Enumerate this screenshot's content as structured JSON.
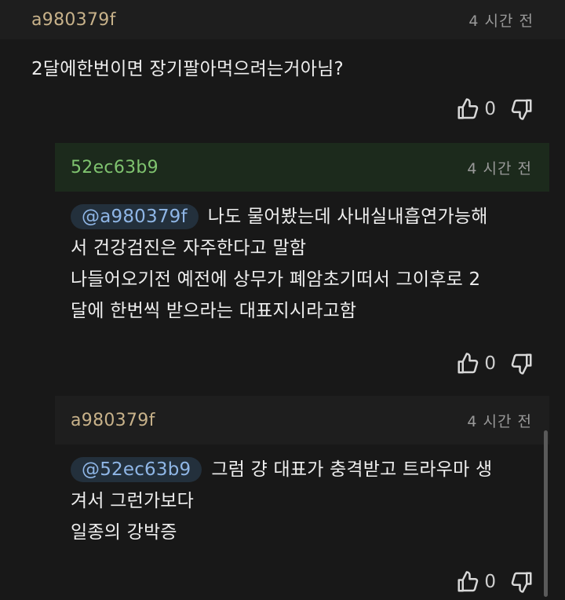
{
  "comments": [
    {
      "author": "a980379f",
      "time": "4 시간 전",
      "mention": "",
      "lines": [
        "2달에한번이면 장기팔아먹으려는거아님?"
      ],
      "up_count": "0"
    },
    {
      "author": "52ec63b9",
      "time": "4 시간 전",
      "mention": "@a980379f",
      "lines": [
        "나도 물어봤는데 사내실내흡연가능해",
        "서 건강검진은 자주한다고 말함",
        "나들어오기전 예전에 상무가 폐암초기떠서 그이후로 2",
        "달에 한번씩 받으라는 대표지시라고함"
      ],
      "up_count": "0"
    },
    {
      "author": "a980379f",
      "time": "4 시간 전",
      "mention": "@52ec63b9",
      "lines": [
        "그럼 걍 대표가 충격받고 트라우마 생",
        "겨서 그런가보다",
        "일종의 강박증"
      ],
      "up_count": "0"
    }
  ],
  "colors": {
    "author_a": "#c8b28a",
    "author_b": "#7fc36f",
    "highlight_bg": "#1c2a1c"
  },
  "icons": [
    "thumbs-up-icon",
    "thumbs-down-icon"
  ]
}
